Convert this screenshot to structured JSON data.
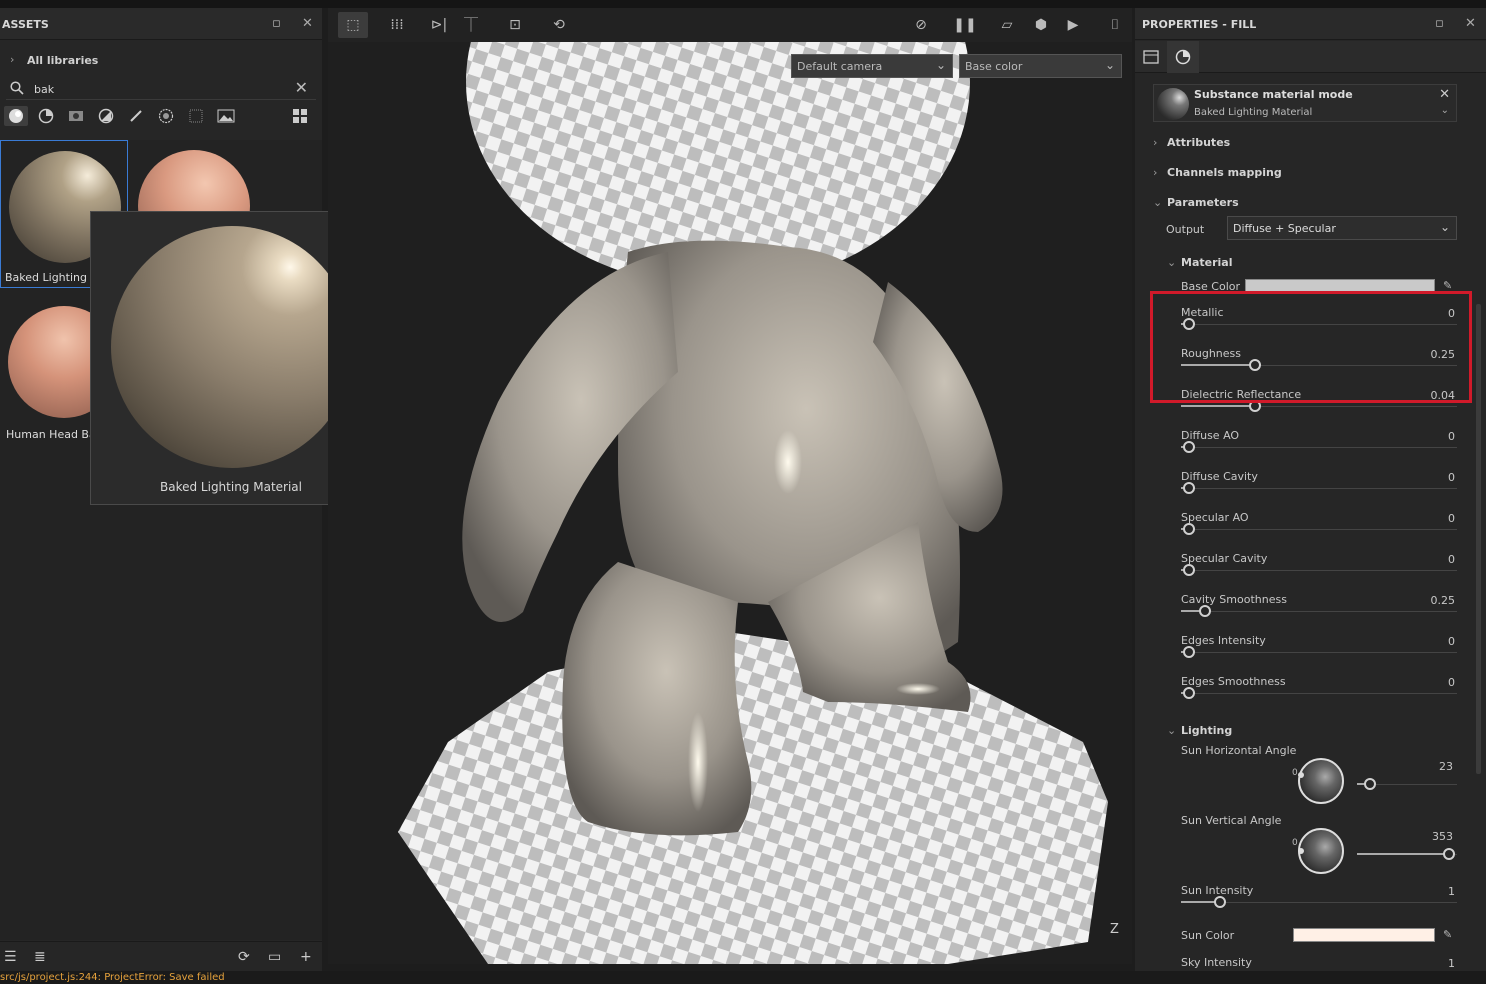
{
  "assets": {
    "title": "ASSETS",
    "all_libraries": "All libraries",
    "search_value": "bak",
    "items": [
      {
        "label": "Baked Lighting M"
      },
      {
        "label": ""
      },
      {
        "label": "Human Head Ba"
      }
    ],
    "tooltip_label": "Baked Lighting Material"
  },
  "status": {
    "text": "src/js/project.js:244: ProjectError: Save failed"
  },
  "viewport": {
    "camera": "Default camera",
    "channel": "Base color",
    "axis_label": "Z"
  },
  "properties": {
    "title": "PROPERTIES - FILL",
    "mode_title": "Substance material mode",
    "mode_value": "Baked Lighting Material",
    "sections": {
      "attributes": "Attributes",
      "channels": "Channels mapping",
      "parameters": "Parameters",
      "material": "Material",
      "lighting": "Lighting"
    },
    "output_label": "Output",
    "output_value": "Diffuse + Specular",
    "base_color_label": "Base Color",
    "material_params": [
      {
        "name": "Metallic",
        "value": "0",
        "frac": 0.0
      },
      {
        "name": "Roughness",
        "value": "0.25",
        "frac": 0.25
      },
      {
        "name": "Dielectric Reflectance",
        "value": "0.04",
        "frac": 0.25
      },
      {
        "name": "Diffuse AO",
        "value": "0",
        "frac": 0.0
      },
      {
        "name": "Diffuse Cavity",
        "value": "0",
        "frac": 0.0
      },
      {
        "name": "Specular AO",
        "value": "0",
        "frac": 0.0
      },
      {
        "name": "Specular Cavity",
        "value": "0",
        "frac": 0.0
      },
      {
        "name": "Cavity Smoothness",
        "value": "0.25",
        "frac": 0.06
      },
      {
        "name": "Edges Intensity",
        "value": "0",
        "frac": 0.0
      },
      {
        "name": "Edges Smoothness",
        "value": "0",
        "frac": 0.0
      }
    ],
    "sun_h": {
      "label": "Sun Horizontal Angle",
      "value": "23",
      "frac": 0.06,
      "dial_zero": "0"
    },
    "sun_v": {
      "label": "Sun Vertical Angle",
      "value": "353",
      "frac": 0.98,
      "dial_zero": "0"
    },
    "sun_intensity": {
      "label": "Sun Intensity",
      "value": "1",
      "frac": 0.12
    },
    "sun_color_label": "Sun Color",
    "sky_intensity": {
      "label": "Sky Intensity",
      "value": "1"
    }
  },
  "colors": {
    "highlight": "#d11a2a",
    "base_color": "#c9c9c9",
    "sun_color": "#fff0e6",
    "status_text": "#e6a23c"
  }
}
